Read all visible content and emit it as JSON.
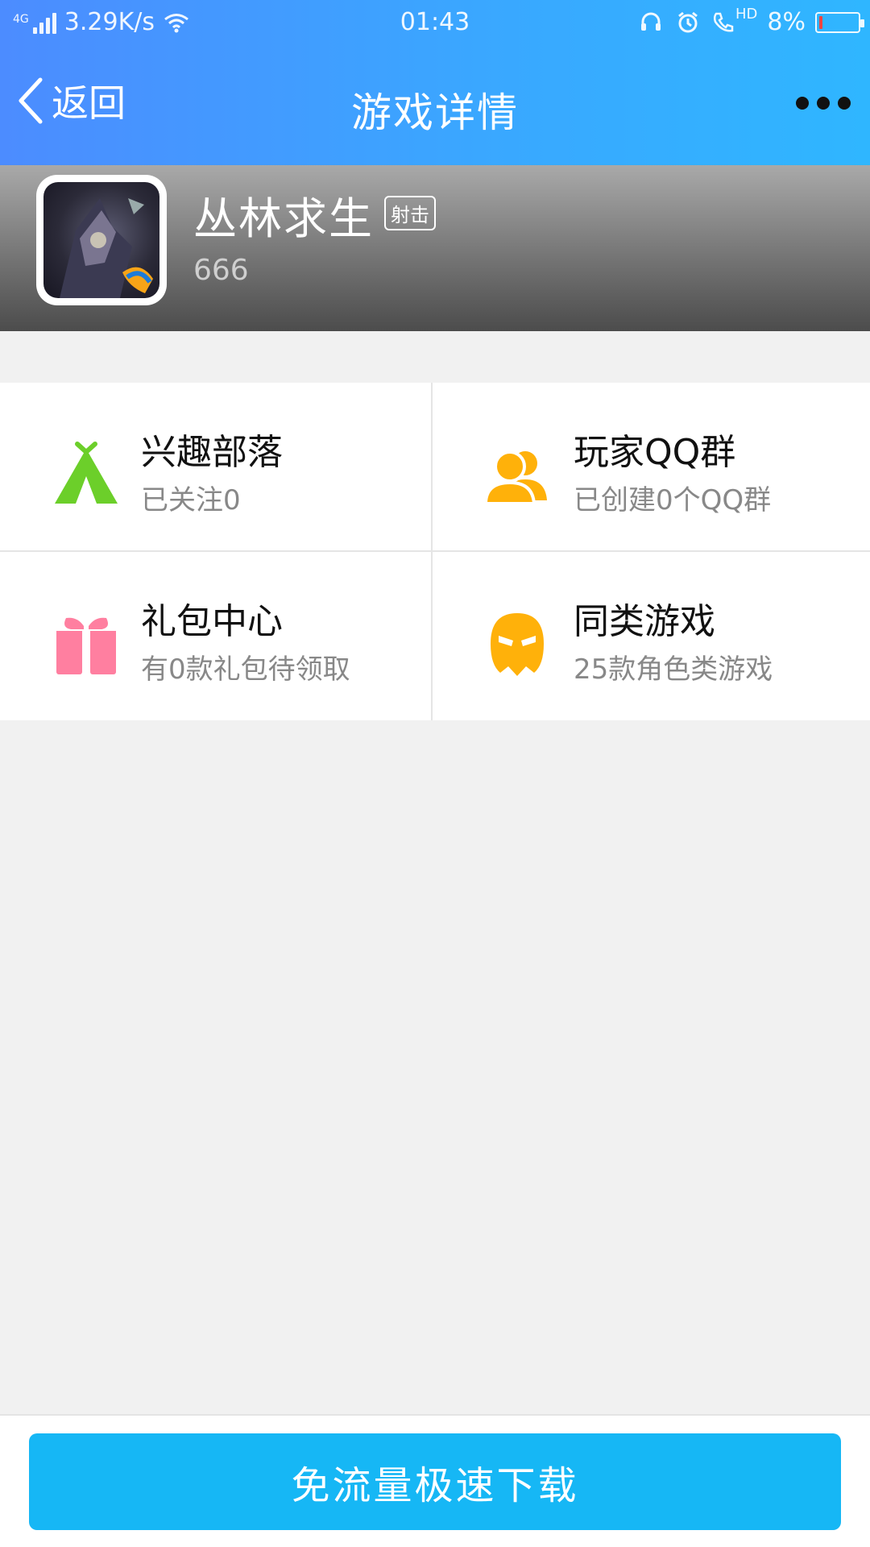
{
  "status_bar": {
    "network": "4G",
    "speed": "3.29K/s",
    "time": "01:43",
    "hd": "HD",
    "battery": "8%"
  },
  "nav": {
    "back_label": "返回",
    "title": "游戏详情"
  },
  "game": {
    "name": "丛林求生",
    "tag": "射击",
    "description": "666"
  },
  "grid": [
    {
      "title": "兴趣部落",
      "subtitle": "已关注0",
      "icon": "tent-icon",
      "color": "#6ccf2a"
    },
    {
      "title": "玩家QQ群",
      "subtitle": "已创建0个QQ群",
      "icon": "group-icon",
      "color": "#ffb10a"
    },
    {
      "title": "礼包中心",
      "subtitle": "有0款礼包待领取",
      "icon": "gift-icon",
      "color": "#ff7fa0"
    },
    {
      "title": "同类游戏",
      "subtitle": "25款角色类游戏",
      "icon": "mask-icon",
      "color": "#ffb10a"
    }
  ],
  "download": {
    "label": "免流量极速下载"
  },
  "colors": {
    "primary": "#16b7f5",
    "nav_gradient_start": "#4c8cff",
    "nav_gradient_end": "#2fb6ff"
  }
}
